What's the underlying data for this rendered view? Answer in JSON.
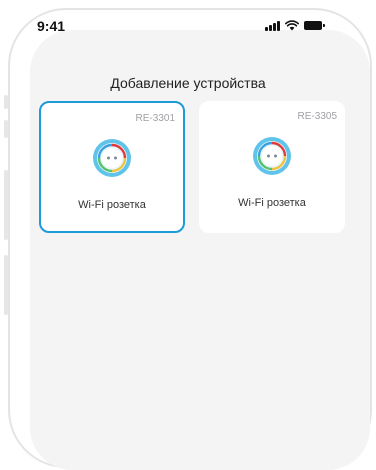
{
  "status_bar": {
    "time": "9:41",
    "icons": [
      "signal-icon",
      "wifi-icon",
      "battery-icon"
    ]
  },
  "page": {
    "title": "Добавление устройства"
  },
  "devices": [
    {
      "model": "RE-3301",
      "name": "Wi-Fi розетка",
      "icon": "smart-plug-icon",
      "selected": true
    },
    {
      "model": "RE-3305",
      "name": "Wi-Fi розетка",
      "icon": "smart-plug-icon",
      "selected": false
    }
  ],
  "colors": {
    "accent": "#1d9bd8",
    "background": "#f4f4f5",
    "card": "#ffffff"
  }
}
